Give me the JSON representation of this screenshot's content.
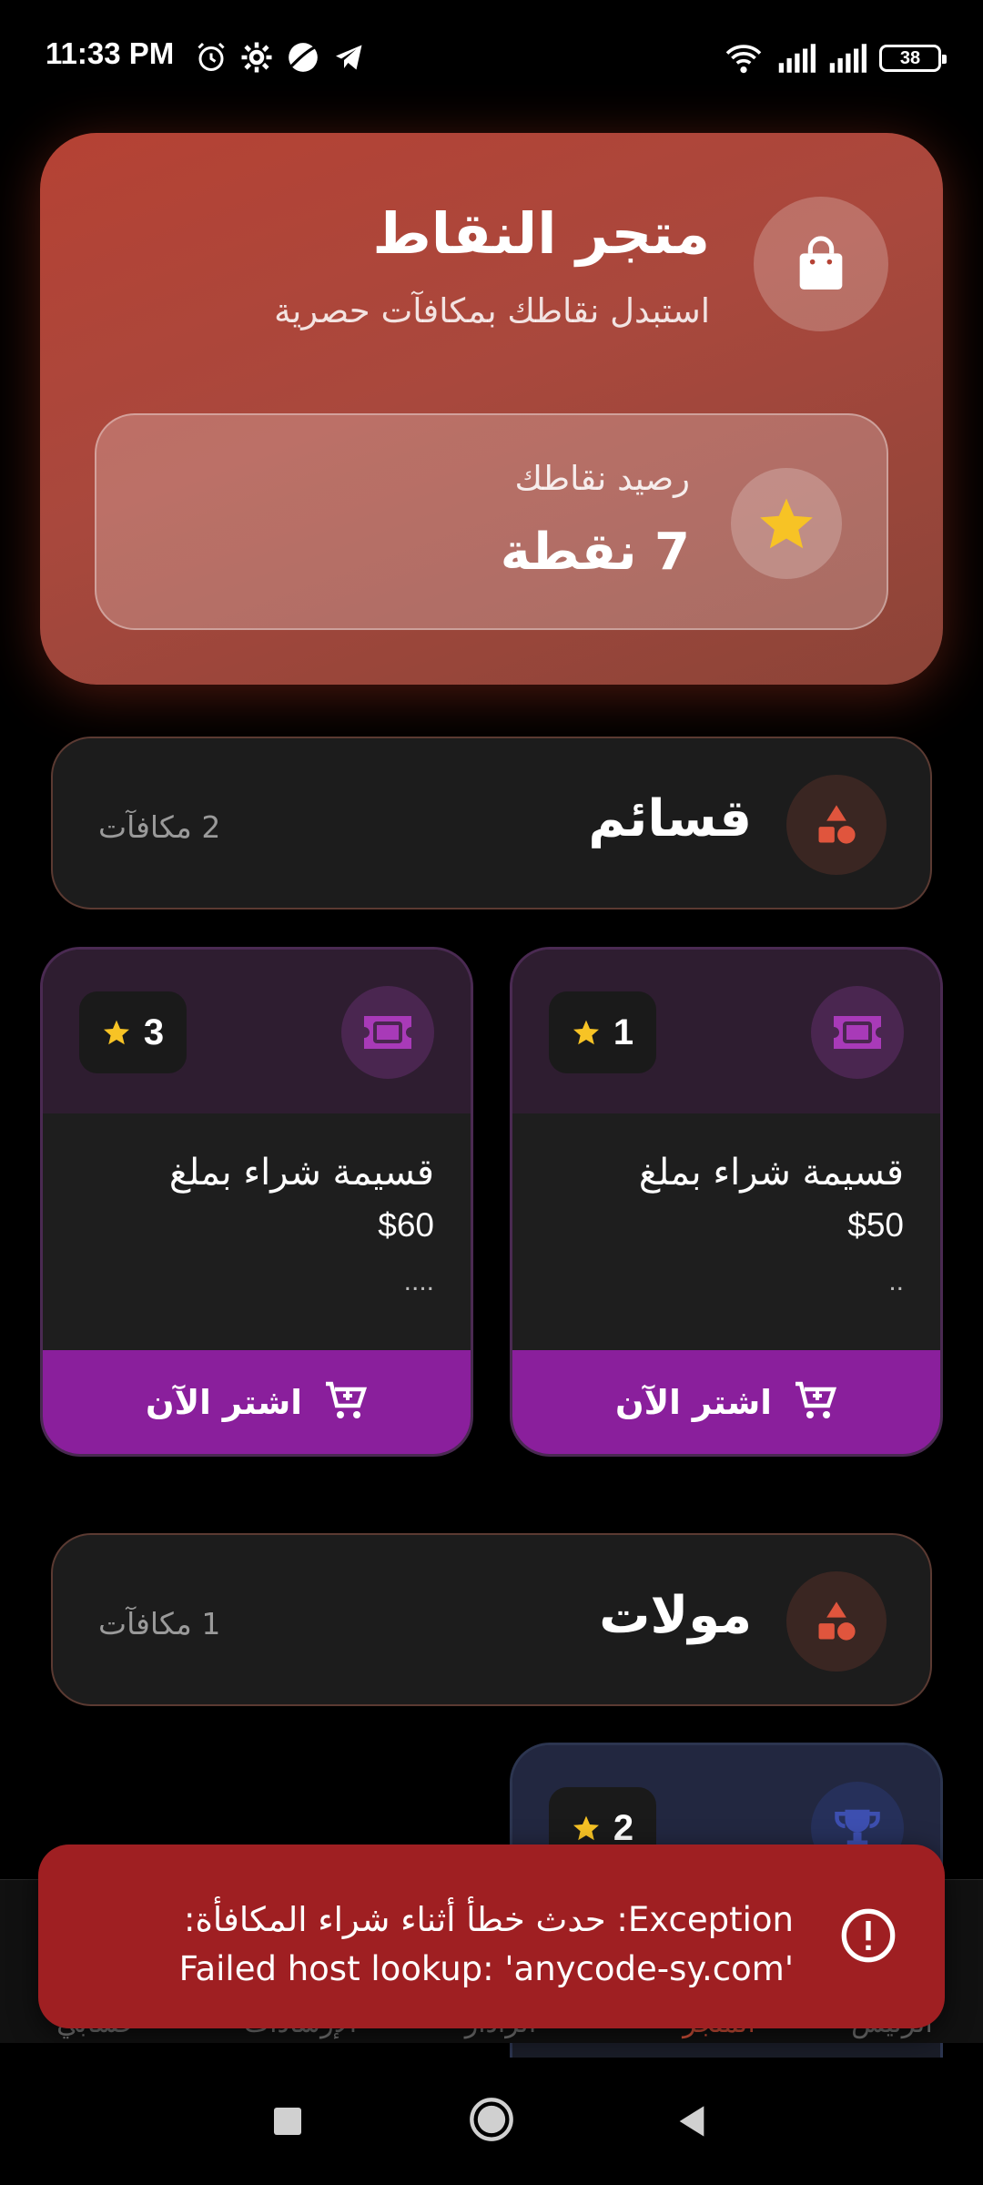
{
  "status_bar": {
    "time": "11:33 PM",
    "battery": "38",
    "icons_left": [
      "alarm-icon",
      "gear-icon",
      "planet-icon",
      "telegram-icon"
    ],
    "icons_right": [
      "wifi-icon",
      "signal-icon",
      "signal-icon",
      "battery-icon"
    ]
  },
  "header": {
    "title": "متجر النقاط",
    "subtitle": "استبدل نقاطك بمكافآت حصرية",
    "icon": "shopping-bag-icon",
    "balance_label": "رصيد نقاطك",
    "balance_value": "7 نقطة",
    "balance_icon": "star-icon"
  },
  "categories": [
    {
      "title": "قسائم",
      "count": "2 مكافآت",
      "icon": "shapes-icon",
      "products": [
        {
          "title": "قسيمة شراء بملغ",
          "price": "$50",
          "desc": "..",
          "points": "1",
          "icon": "ticket-icon",
          "buy_label": "اشتر الآن"
        },
        {
          "title": "قسيمة شراء بملغ",
          "price": "$60",
          "desc": "....",
          "points": "3",
          "icon": "ticket-icon",
          "buy_label": "اشتر الآن"
        }
      ]
    },
    {
      "title": "مولات",
      "count": "1 مكافآت",
      "icon": "shapes-icon",
      "products": [
        {
          "points": "2",
          "icon": "trophy-icon"
        }
      ]
    }
  ],
  "bottom_nav": {
    "items": [
      "الرئيس",
      "المتجر",
      "الرادار",
      "الإرشادات",
      "حسابي"
    ],
    "active_index": 1
  },
  "snackbar": {
    "message": "Exception: حدث خطأ أثناء شراء المكافأة: 'Failed host lookup: 'anycode-sy.com",
    "icon": "error-circle-icon"
  },
  "colors": {
    "accent_purple": "#8a1f9c",
    "header_red": "#b54234",
    "error_red": "#9f1f22",
    "star_yellow": "#f7c325"
  }
}
